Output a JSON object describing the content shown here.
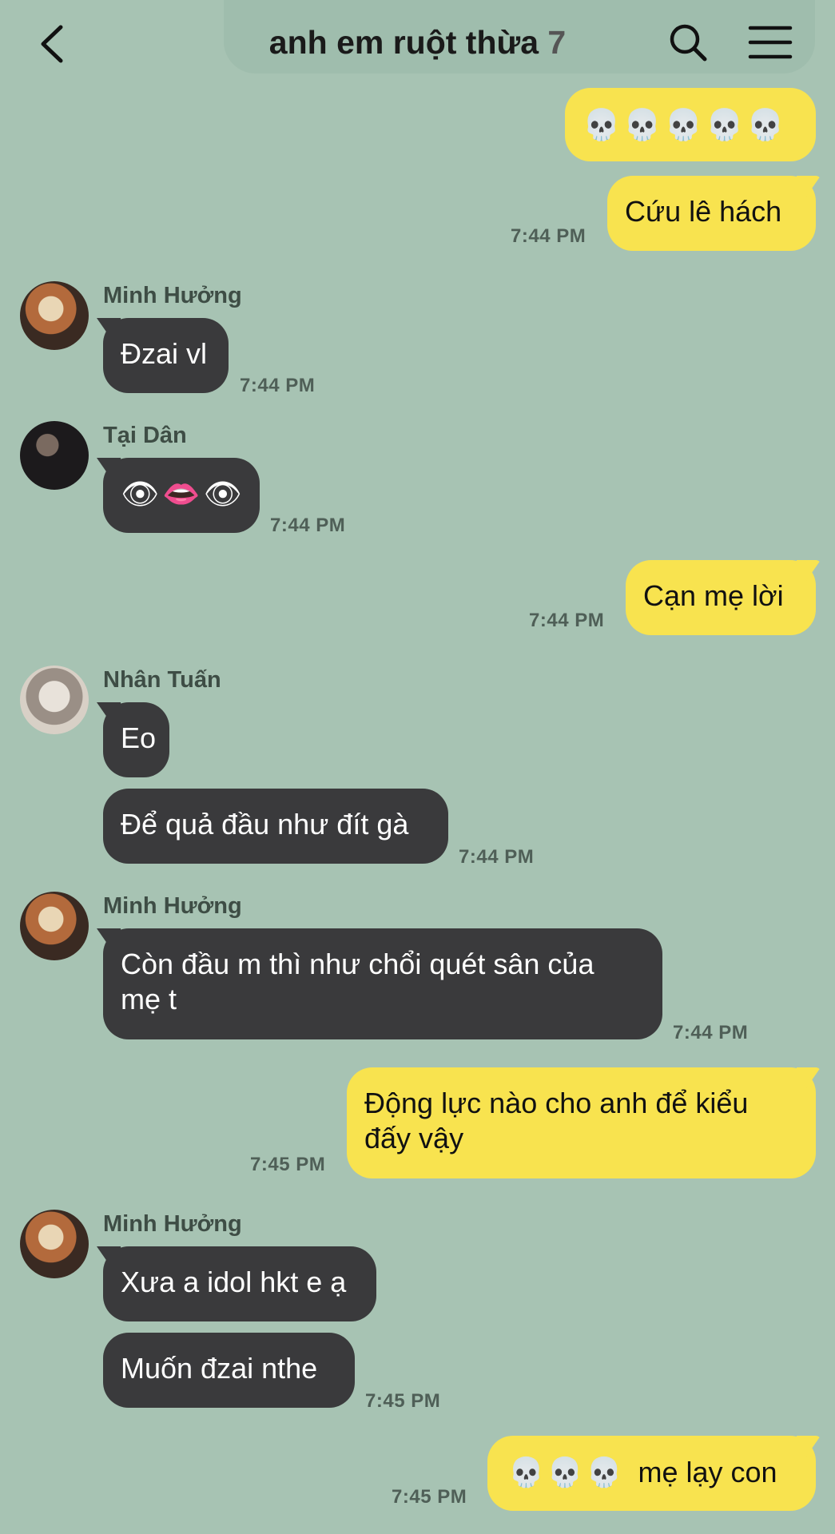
{
  "header": {
    "title": "anh em ruột thừa",
    "member_count": "7"
  },
  "messages": [
    {
      "side": "mine",
      "text": "💀💀💀💀💀"
    },
    {
      "side": "mine",
      "text": "Cứu lê hách",
      "time": "7:44 PM"
    },
    {
      "side": "theirs",
      "sender": "Minh Hưởng",
      "text": "Đzai vl",
      "time": "7:44 PM"
    },
    {
      "side": "theirs",
      "sender": "Tại Dân",
      "text": "👁👄👁",
      "time": "7:44 PM"
    },
    {
      "side": "mine",
      "text": "Cạn mẹ lời",
      "time": "7:44 PM"
    },
    {
      "side": "theirs",
      "sender": "Nhân Tuấn",
      "text": "Eo"
    },
    {
      "side": "theirs",
      "text": "Để quả đầu như đít gà",
      "time": "7:44 PM"
    },
    {
      "side": "theirs",
      "sender": "Minh Hưởng",
      "line1": "Còn đầu m thì như chổi quét sân của",
      "line2": "mẹ t",
      "time": "7:44 PM"
    },
    {
      "side": "mine",
      "line1": "Động lực nào cho anh để kiểu",
      "line2": "đấy vậy",
      "time": "7:45 PM"
    },
    {
      "side": "theirs",
      "sender": "Minh Hưởng",
      "text": "Xưa a idol hkt e ạ"
    },
    {
      "side": "theirs",
      "text": "Muốn đzai nthe",
      "time": "7:45 PM"
    },
    {
      "side": "mine",
      "text": "mẹ lạy con",
      "time": "7:45 PM"
    }
  ],
  "colors": {
    "background": "#a7c3b3",
    "mine_bubble": "#f8e34f",
    "theirs_bubble": "#3a3a3c"
  }
}
